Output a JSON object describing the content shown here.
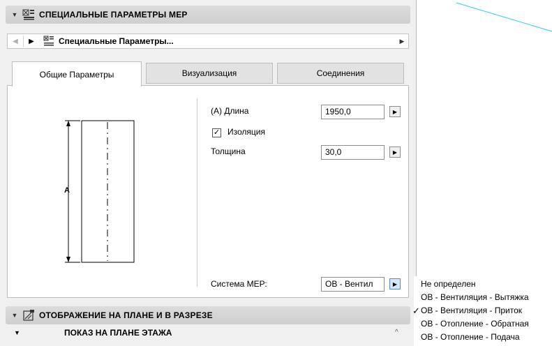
{
  "section_mep": {
    "title": "СПЕЦИАЛЬНЫЕ ПАРАМЕТРЫ МЕР"
  },
  "navigator": {
    "label": "Специальные Параметры..."
  },
  "tabs": [
    {
      "label": "Общие Параметры"
    },
    {
      "label": "Визуализация"
    },
    {
      "label": "Соединения"
    }
  ],
  "diagram": {
    "dimension_letter": "A"
  },
  "params": {
    "length_label": "(А) Длина",
    "length_value": "1950,0",
    "insulation_label": "Изоляция",
    "insulation_checked": true,
    "thickness_label": "Толщина",
    "thickness_value": "30,0",
    "system_label": "Система МЕР:",
    "system_value": "ОВ - Вентил"
  },
  "section_floor_plan": {
    "title": "ОТОБРАЖЕНИЕ НА ПЛАНЕ И В РАЗРЕЗЕ"
  },
  "subsection": {
    "title": "ПОКАЗ НА ПЛАНЕ ЭТАЖА"
  },
  "dropdown": {
    "items": [
      {
        "label": "Не определен",
        "checked": false
      },
      {
        "label": "ОВ - Вентиляция - Вытяжка",
        "checked": false
      },
      {
        "label": "ОВ - Вентиляция - Приток",
        "checked": true
      },
      {
        "label": "ОВ - Отопление - Обратная",
        "checked": false
      },
      {
        "label": "ОВ - Отопление - Подача",
        "checked": false
      }
    ]
  },
  "colors": {
    "canvas_line": "#38c8e0",
    "header_bg": "#d3d3d3",
    "panel_bg": "#f0f0f0"
  }
}
